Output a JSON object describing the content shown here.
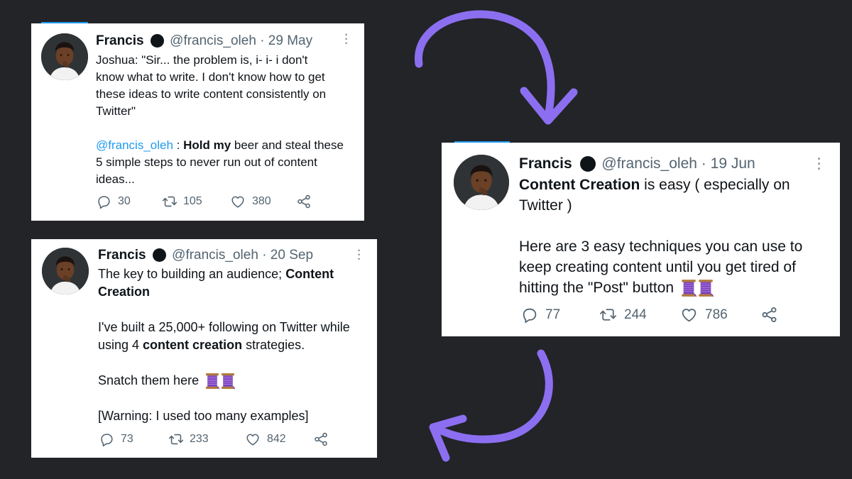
{
  "colors": {
    "background": "#222428",
    "arrow": "#8c6ff0",
    "link": "#1d9bf0",
    "muted": "#536471"
  },
  "tweet1": {
    "name": "Francis",
    "handle": "@francis_oleh",
    "sep": "·",
    "date": "29 May",
    "line1": "Joshua: \"Sir... the problem is, i- i- i don't",
    "line2": "know what to write. I don't know how to get",
    "line3": "these ideas to write content consistently on",
    "line4": "Twitter\"",
    "mention": "@francis_oleh",
    "after_mention": " : ",
    "bold1": "Hold my",
    "rest1": " beer and steal these",
    "line6": "5 simple steps to never run out of content",
    "line7": "ideas...",
    "replies": "30",
    "retweets": "105",
    "likes": "380"
  },
  "tweet2": {
    "name": "Francis",
    "handle": "@francis_oleh",
    "sep": "·",
    "date": "19 Jun",
    "bold_lead": "Content Creation",
    "line1_rest": " is easy ( especially on",
    "line2": "Twitter )",
    "line3": "Here are 3 easy techniques you can use to",
    "line4": "keep creating content until you get tired of",
    "line5": "hitting the \"Post\" button",
    "replies": "77",
    "retweets": "244",
    "likes": "786"
  },
  "tweet3": {
    "name": "Francis",
    "handle": "@francis_oleh",
    "sep": "·",
    "date": "20 Sep",
    "line1": "The key to building an audience; ",
    "line1_bold": "Content",
    "line2_bold": "Creation",
    "line3": "I've built a 25,000+ following on Twitter while",
    "line4_pre": "using 4 ",
    "line4_bold": "content creation",
    "line4_post": " strategies.",
    "line5": "Snatch them here",
    "line6": "[Warning: I used too many examples]",
    "replies": "73",
    "retweets": "233",
    "likes": "842"
  },
  "icons": {
    "reply": "reply-icon",
    "retweet": "retweet-icon",
    "like": "heart-icon",
    "share": "share-icon",
    "more": "more-options-icon",
    "thread": "thread-spool-icon"
  }
}
